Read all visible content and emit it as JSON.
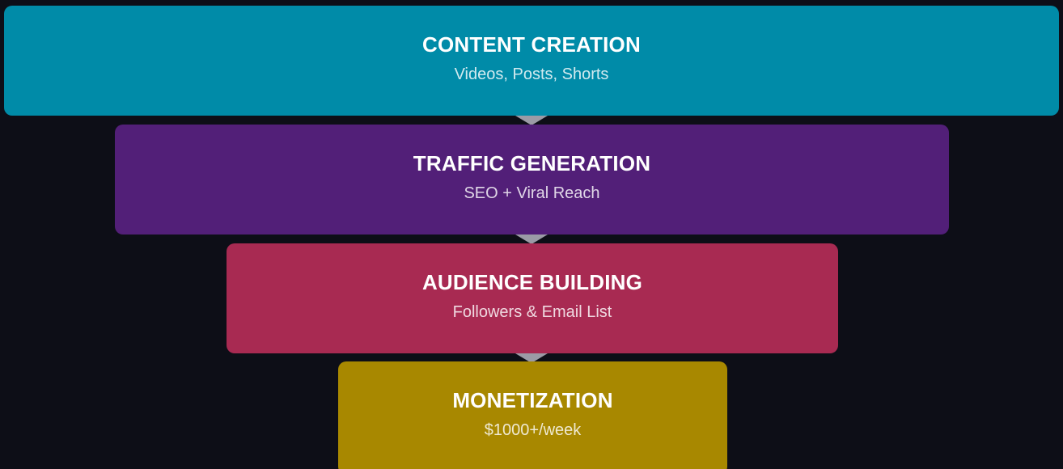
{
  "stages": [
    {
      "title": "CONTENT CREATION",
      "subtitle": "Videos, Posts, Shorts",
      "color": "#008ba8"
    },
    {
      "title": "TRAFFIC GENERATION",
      "subtitle": "SEO + Viral Reach",
      "color": "#521f78"
    },
    {
      "title": "AUDIENCE BUILDING",
      "subtitle": "Followers & Email List",
      "color": "#a82a52"
    },
    {
      "title": "MONETIZATION",
      "subtitle": "$1000+/week",
      "color": "#a88800"
    }
  ],
  "connector_color": "#9b9ba6",
  "background_color": "#0d0e17"
}
